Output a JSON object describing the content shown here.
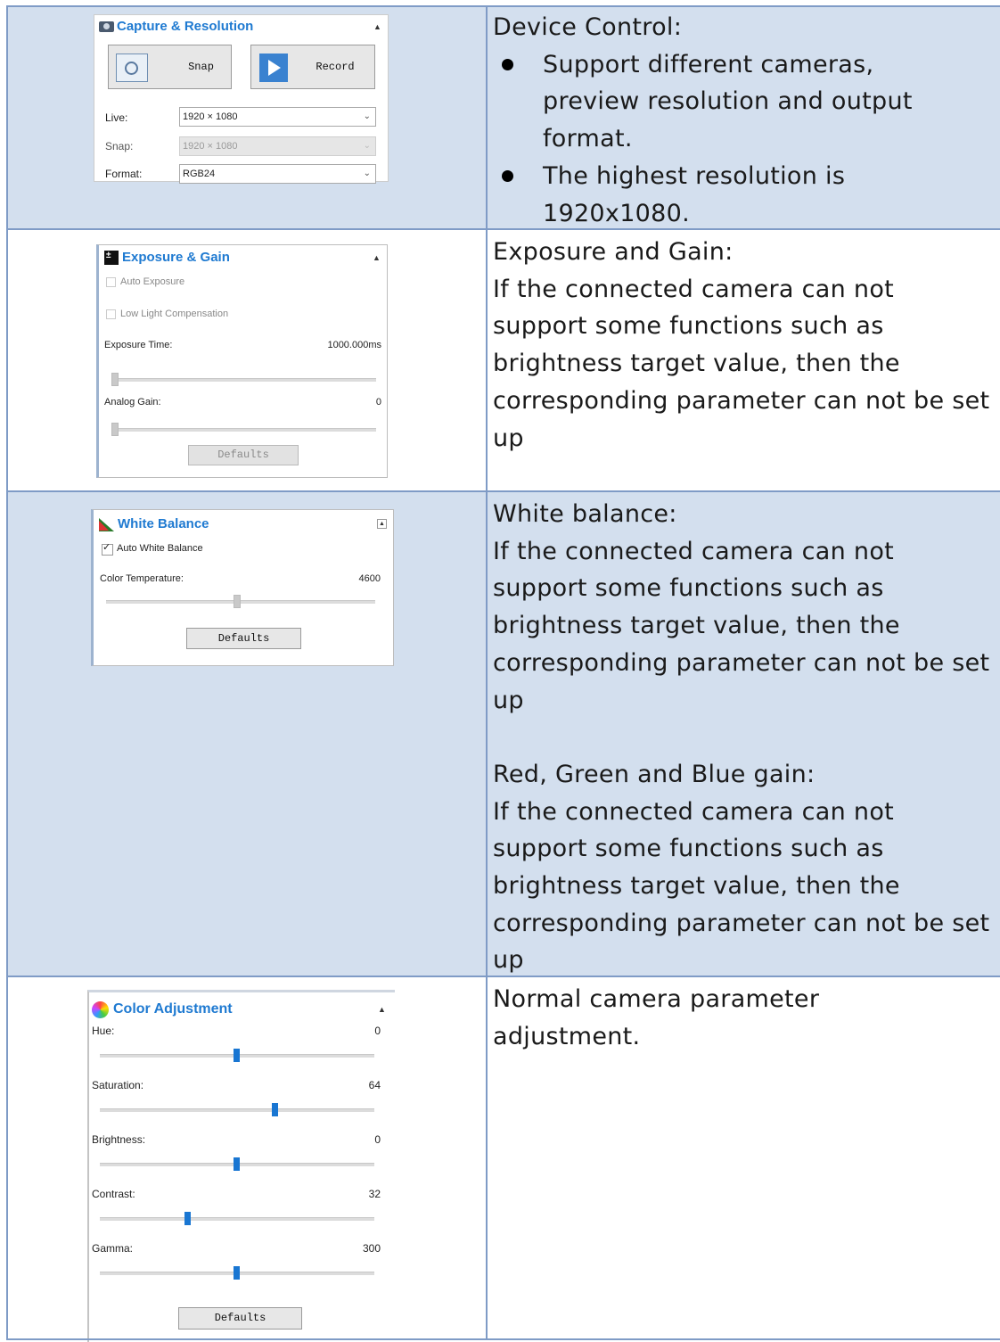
{
  "rows": [
    {
      "desc_title": "Device Control:",
      "bullets": [
        "Support different cameras, preview resolution and output format.",
        "The highest resolution is 1920x1080."
      ],
      "panel": {
        "title": "Capture & Resolution",
        "snap_label": "Snap",
        "record_label": "Record",
        "live_label": "Live:",
        "live_value": "1920 × 1080",
        "snap_res_label": "Snap:",
        "snap_res_value": "1920 × 1080",
        "format_label": "Format:",
        "format_value": "RGB24"
      }
    },
    {
      "desc_title": "Exposure and Gain:",
      "desc_body": "If the connected camera can not support some functions such as brightness target value, then the corresponding parameter can not be set up",
      "panel": {
        "title": "Exposure & Gain",
        "auto_exposure": "Auto Exposure",
        "low_light": "Low Light Compensation",
        "exposure_time_label": "Exposure Time:",
        "exposure_time_value": "1000.000ms",
        "analog_gain_label": "Analog Gain:",
        "analog_gain_value": "0",
        "defaults": "Defaults"
      }
    },
    {
      "desc_title": "White balance:",
      "desc_body": "If the connected camera can not support some functions such as brightness target value, then the corresponding parameter can not be set up",
      "desc_title2": "Red, Green and Blue gain:",
      "desc_body2": "If the connected camera can not support some functions such as brightness target value, then the corresponding parameter can not be set up",
      "panel": {
        "title": "White Balance",
        "auto_wb": "Auto White Balance",
        "auto_wb_checked": true,
        "color_temp_label": "Color Temperature:",
        "color_temp_value": "4600",
        "defaults": "Defaults"
      }
    },
    {
      "desc_body": "Normal camera parameter adjustment.",
      "panel": {
        "title": "Color Adjustment",
        "sliders": [
          {
            "label": "Hue:",
            "value": "0",
            "fraction": 0.5
          },
          {
            "label": "Saturation:",
            "value": "64",
            "fraction": 0.64
          },
          {
            "label": "Brightness:",
            "value": "0",
            "fraction": 0.5
          },
          {
            "label": "Contrast:",
            "value": "32",
            "fraction": 0.32
          },
          {
            "label": "Gamma:",
            "value": "300",
            "fraction": 0.5
          }
        ],
        "defaults": "Defaults"
      }
    }
  ]
}
